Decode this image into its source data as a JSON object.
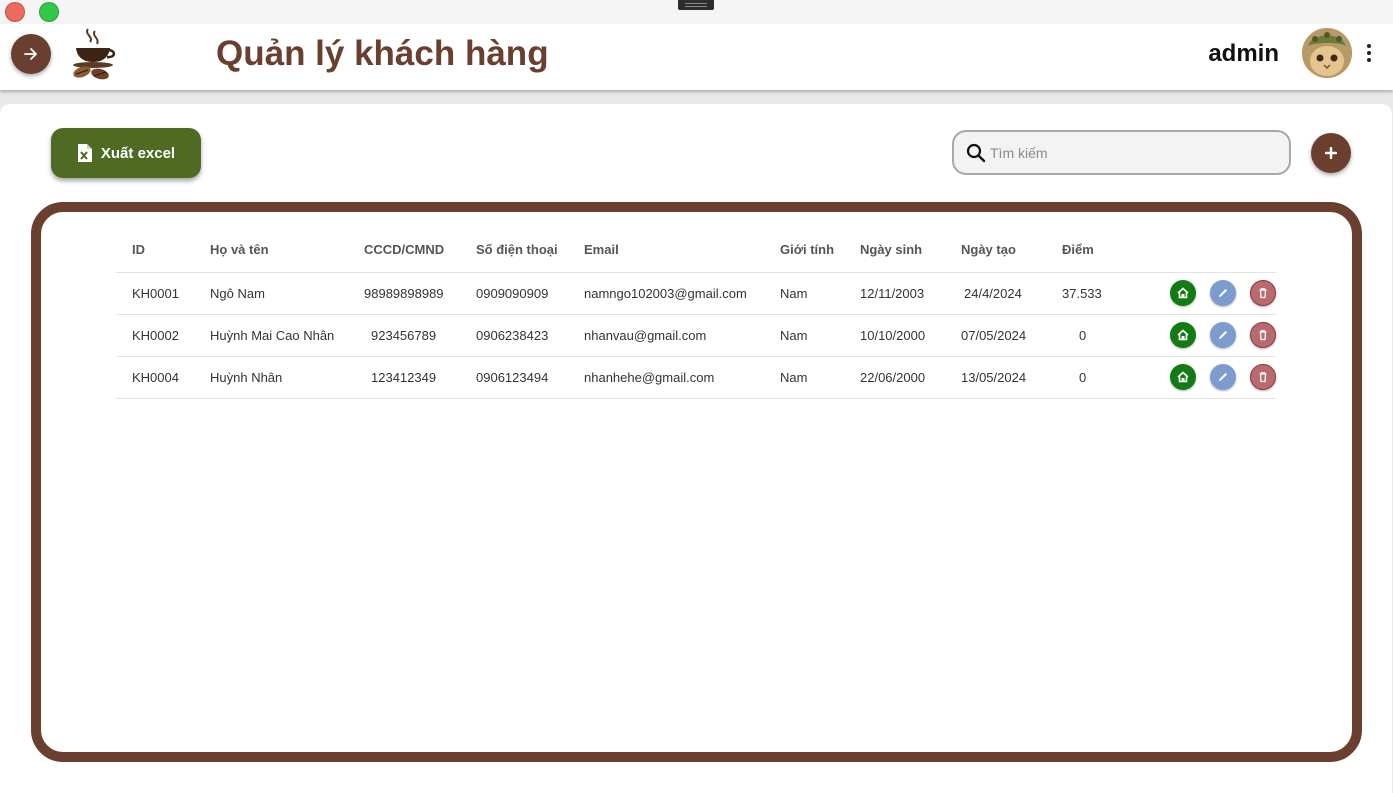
{
  "header": {
    "title": "Quản lý khách hàng",
    "username": "admin"
  },
  "toolbar": {
    "export_label": "Xuất excel",
    "search_placeholder": "Tìm kiếm",
    "search_value": ""
  },
  "table": {
    "columns": [
      "ID",
      "Họ và tên",
      "CCCD/CMND",
      "Số điện thoại",
      "Email",
      "Giới tính",
      "Ngày sinh",
      "Ngày tạo",
      "Điểm",
      ""
    ],
    "rows": [
      [
        "KH0001",
        "Ngô Nam",
        "98989898989",
        "0909090909",
        "namngo102003@gmail.com",
        "Nam",
        "12/11/2003",
        "24/4/2024",
        "37.533"
      ],
      [
        "KH0002",
        "Huỳnh Mai Cao Nhân",
        "923456789",
        "0906238423",
        "nhanvau@gmail.com",
        "Nam",
        "10/10/2000",
        "07/05/2024",
        "0"
      ],
      [
        "KH0004",
        "Huỳnh Nhân",
        "123412349",
        "0906123494",
        "nhanhehe@gmail.com",
        "Nam",
        "22/06/2000",
        "13/05/2024",
        "0"
      ]
    ]
  },
  "icons": {
    "nav": "arrow-right-icon",
    "export": "excel-file-icon",
    "search": "search-icon",
    "add": "plus-icon",
    "row_view": "home-icon",
    "row_edit": "pencil-icon",
    "row_delete": "trash-icon",
    "more": "more-vertical-icon"
  },
  "colors": {
    "brand": "#6b3f2f",
    "export": "#4f6b23",
    "view": "#137b13",
    "edit": "#7b9ccc",
    "delete": "#b86a6e"
  }
}
